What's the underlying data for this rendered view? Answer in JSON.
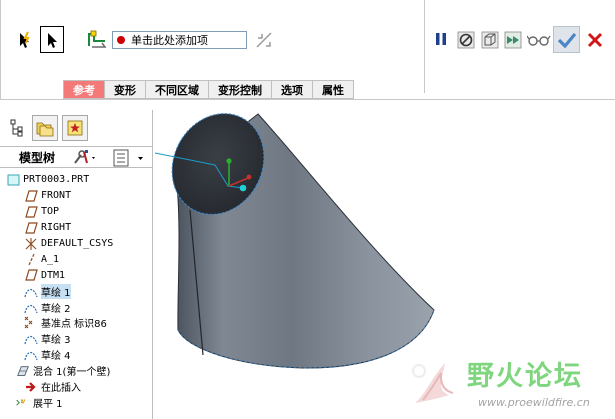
{
  "dashboard": {
    "collector_text": "单击此处添加项",
    "tabs": [
      {
        "label": "参考",
        "active": true
      },
      {
        "label": "变形",
        "active": false
      },
      {
        "label": "不同区域",
        "active": false
      },
      {
        "label": "变形控制",
        "active": false
      },
      {
        "label": "选项",
        "active": false
      },
      {
        "label": "属性",
        "active": false
      }
    ],
    "ok_color": "#4a86c5",
    "cancel_color": "#d01818"
  },
  "navigator": {
    "title": "模型树",
    "items": [
      {
        "label": "PRT0003.PRT",
        "icon": "part-icon",
        "cjk": false
      },
      {
        "label": "FRONT",
        "icon": "datum-plane-icon",
        "cjk": false
      },
      {
        "label": "TOP",
        "icon": "datum-plane-icon",
        "cjk": false
      },
      {
        "label": "RIGHT",
        "icon": "datum-plane-icon",
        "cjk": false
      },
      {
        "label": "DEFAULT_CSYS",
        "icon": "csys-icon",
        "cjk": false
      },
      {
        "label": "A_1",
        "icon": "axis-icon",
        "cjk": false
      },
      {
        "label": "DTM1",
        "icon": "datum-plane-icon",
        "cjk": false
      },
      {
        "label": "草绘 1",
        "icon": "sketch-icon",
        "cjk": true,
        "selected": true
      },
      {
        "label": "草绘 2",
        "icon": "sketch-icon",
        "cjk": true
      },
      {
        "label": "基准点 标识86",
        "icon": "datum-point-icon",
        "cjk": true
      },
      {
        "label": "草绘 3",
        "icon": "sketch-icon",
        "cjk": true
      },
      {
        "label": "草绘 4",
        "icon": "sketch-icon",
        "cjk": true
      },
      {
        "label": "混合 1(第一个壁)",
        "icon": "blend-icon",
        "cjk": true
      },
      {
        "label": "在此插入",
        "icon": "insert-arrow-icon",
        "cjk": true
      },
      {
        "label": "展平 1",
        "icon": "flatten-icon",
        "cjk": true
      }
    ]
  },
  "watermark": {
    "text": "野火论坛",
    "url": "www.proewildfire.cn"
  }
}
